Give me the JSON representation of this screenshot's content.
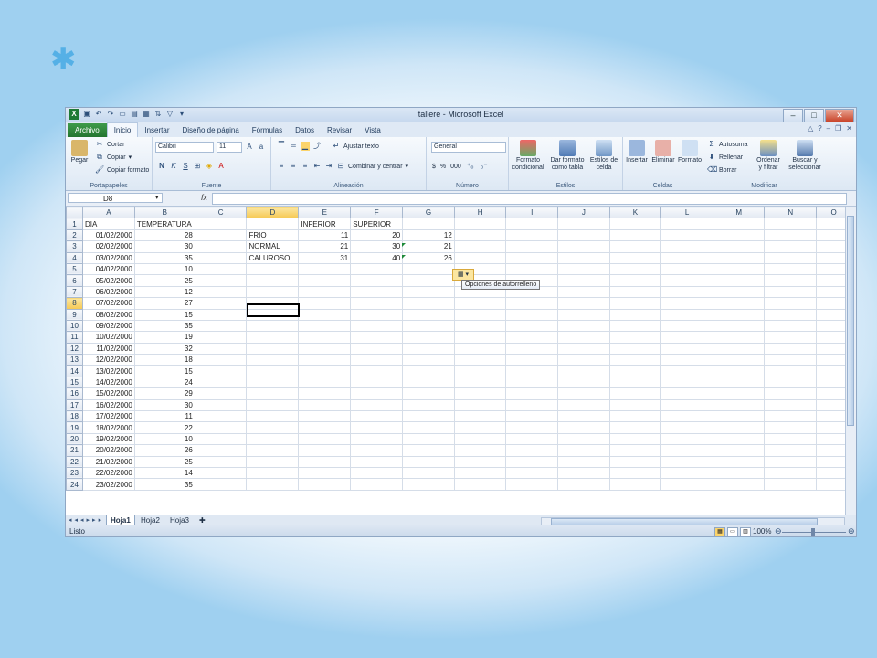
{
  "window": {
    "title": "tallere - Microsoft Excel"
  },
  "tabs": [
    "Archivo",
    "Inicio",
    "Insertar",
    "Diseño de página",
    "Fórmulas",
    "Datos",
    "Revisar",
    "Vista"
  ],
  "ribbon": {
    "portapapeles": {
      "pegar": "Pegar",
      "cortar": "Cortar",
      "copiar": "Copiar",
      "copiar_formato": "Copiar formato",
      "label": "Portapapeles"
    },
    "fuente": {
      "font": "Calibri",
      "size": "11",
      "label": "Fuente",
      "bold": "N",
      "italic": "K",
      "underline": "S"
    },
    "alineacion": {
      "ajustar": "Ajustar texto",
      "combinar": "Combinar y centrar",
      "label": "Alineación"
    },
    "numero": {
      "format": "General",
      "currency": "$",
      "percent": "%",
      "thousands": "000",
      "label": "Número"
    },
    "estilos": {
      "formato_condicional": "Formato condicional",
      "dar_formato": "Dar formato como tabla",
      "estilos_celda": "Estilos de celda",
      "label": "Estilos"
    },
    "celdas": {
      "insertar": "Insertar",
      "eliminar": "Eliminar",
      "formato": "Formato",
      "label": "Celdas"
    },
    "modificar": {
      "autosuma": "Autosuma",
      "rellenar": "Rellenar",
      "borrar": "Borrar",
      "ordenar": "Ordenar y filtrar",
      "buscar": "Buscar y seleccionar",
      "label": "Modificar"
    }
  },
  "formula_bar": {
    "name_box": "D8",
    "fx": "fx",
    "value": ""
  },
  "columns": [
    "A",
    "B",
    "C",
    "D",
    "E",
    "F",
    "G",
    "H",
    "I",
    "J",
    "K",
    "L",
    "M",
    "N",
    "O"
  ],
  "rows": [
    [
      "DIA",
      "TEMPERATURA",
      "",
      "",
      "INFERIOR",
      "SUPERIOR",
      "",
      "",
      "",
      "",
      "",
      "",
      "",
      "",
      ""
    ],
    [
      "01/02/2000",
      "28",
      "",
      "FRIO",
      "11",
      "20",
      "12",
      "",
      "",
      "",
      "",
      "",
      "",
      "",
      ""
    ],
    [
      "02/02/2000",
      "30",
      "",
      "NORMAL",
      "21",
      "30",
      "21",
      "",
      "",
      "",
      "",
      "",
      "",
      "",
      ""
    ],
    [
      "03/02/2000",
      "35",
      "",
      "CALUROSO",
      "31",
      "40",
      "26",
      "",
      "",
      "",
      "",
      "",
      "",
      "",
      ""
    ],
    [
      "04/02/2000",
      "10",
      "",
      "",
      "",
      "",
      "",
      "",
      "",
      "",
      "",
      "",
      "",
      "",
      ""
    ],
    [
      "05/02/2000",
      "25",
      "",
      "",
      "",
      "",
      "",
      "",
      "",
      "",
      "",
      "",
      "",
      "",
      ""
    ],
    [
      "06/02/2000",
      "12",
      "",
      "",
      "",
      "",
      "",
      "",
      "",
      "",
      "",
      "",
      "",
      "",
      ""
    ],
    [
      "07/02/2000",
      "27",
      "",
      "",
      "",
      "",
      "",
      "",
      "",
      "",
      "",
      "",
      "",
      "",
      ""
    ],
    [
      "08/02/2000",
      "15",
      "",
      "",
      "",
      "",
      "",
      "",
      "",
      "",
      "",
      "",
      "",
      "",
      ""
    ],
    [
      "09/02/2000",
      "35",
      "",
      "",
      "",
      "",
      "",
      "",
      "",
      "",
      "",
      "",
      "",
      "",
      ""
    ],
    [
      "10/02/2000",
      "19",
      "",
      "",
      "",
      "",
      "",
      "",
      "",
      "",
      "",
      "",
      "",
      "",
      ""
    ],
    [
      "11/02/2000",
      "32",
      "",
      "",
      "",
      "",
      "",
      "",
      "",
      "",
      "",
      "",
      "",
      "",
      ""
    ],
    [
      "12/02/2000",
      "18",
      "",
      "",
      "",
      "",
      "",
      "",
      "",
      "",
      "",
      "",
      "",
      "",
      ""
    ],
    [
      "13/02/2000",
      "15",
      "",
      "",
      "",
      "",
      "",
      "",
      "",
      "",
      "",
      "",
      "",
      "",
      ""
    ],
    [
      "14/02/2000",
      "24",
      "",
      "",
      "",
      "",
      "",
      "",
      "",
      "",
      "",
      "",
      "",
      "",
      ""
    ],
    [
      "15/02/2000",
      "29",
      "",
      "",
      "",
      "",
      "",
      "",
      "",
      "",
      "",
      "",
      "",
      "",
      ""
    ],
    [
      "16/02/2000",
      "30",
      "",
      "",
      "",
      "",
      "",
      "",
      "",
      "",
      "",
      "",
      "",
      "",
      ""
    ],
    [
      "17/02/2000",
      "11",
      "",
      "",
      "",
      "",
      "",
      "",
      "",
      "",
      "",
      "",
      "",
      "",
      ""
    ],
    [
      "18/02/2000",
      "22",
      "",
      "",
      "",
      "",
      "",
      "",
      "",
      "",
      "",
      "",
      "",
      "",
      ""
    ],
    [
      "19/02/2000",
      "10",
      "",
      "",
      "",
      "",
      "",
      "",
      "",
      "",
      "",
      "",
      "",
      "",
      ""
    ],
    [
      "20/02/2000",
      "26",
      "",
      "",
      "",
      "",
      "",
      "",
      "",
      "",
      "",
      "",
      "",
      "",
      ""
    ],
    [
      "21/02/2000",
      "25",
      "",
      "",
      "",
      "",
      "",
      "",
      "",
      "",
      "",
      "",
      "",
      "",
      ""
    ],
    [
      "22/02/2000",
      "14",
      "",
      "",
      "",
      "",
      "",
      "",
      "",
      "",
      "",
      "",
      "",
      "",
      ""
    ],
    [
      "23/02/2000",
      "35",
      "",
      "",
      "",
      "",
      "",
      "",
      "",
      "",
      "",
      "",
      "",
      "",
      ""
    ]
  ],
  "autofill": {
    "tooltip": "Opciones de autorrelleno"
  },
  "sheets": [
    "Hoja1",
    "Hoja2",
    "Hoja3"
  ],
  "active_sheet": "Hoja1",
  "status": {
    "text": "Listo",
    "zoom": "100%"
  },
  "colors": {
    "accent": "#1e7a35",
    "selected_header": "#f6c953",
    "background": "#9fd0f0"
  }
}
